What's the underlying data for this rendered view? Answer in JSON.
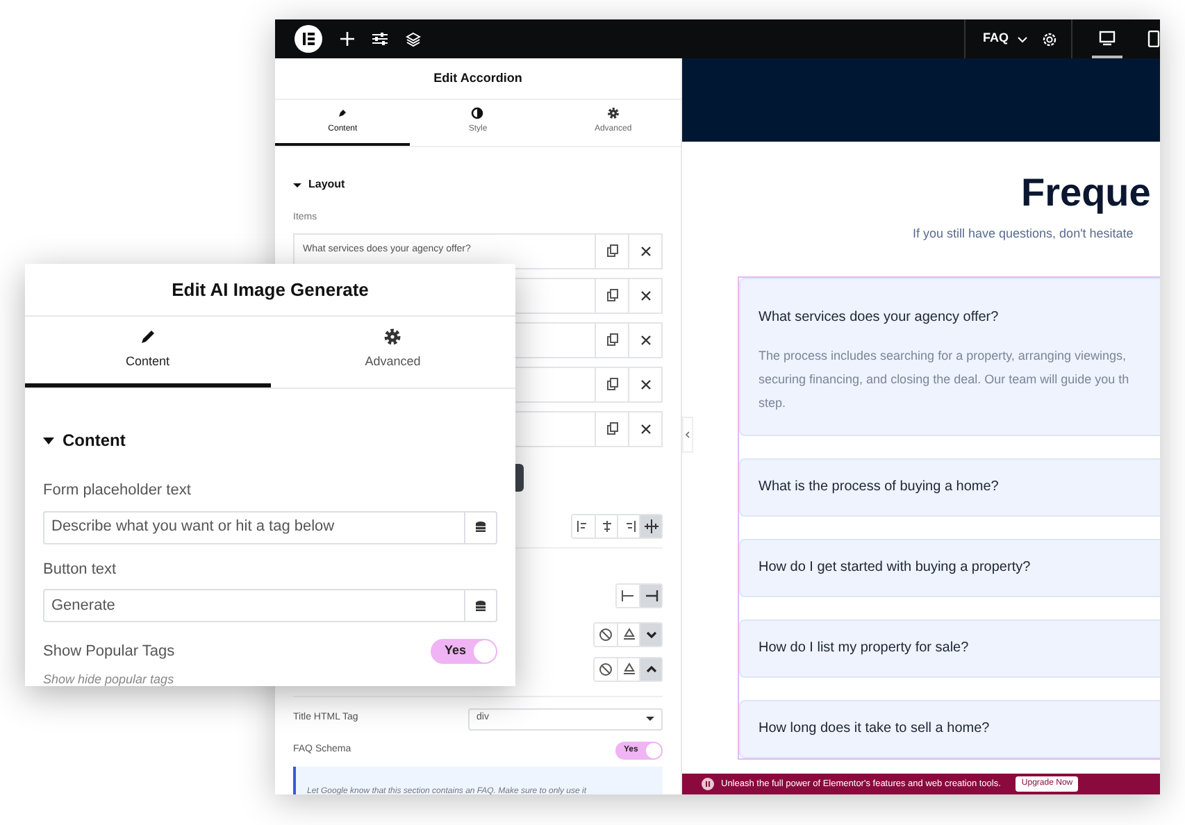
{
  "editor": {
    "toolbar": {
      "page_menu": "FAQ"
    },
    "panel": {
      "title": "Edit Accordion",
      "tabs": [
        {
          "label": "Content",
          "kind": "pencil",
          "selected": true
        },
        {
          "label": "Style",
          "kind": "contrast",
          "selected": false
        },
        {
          "label": "Advanced",
          "kind": "gear",
          "selected": false
        }
      ],
      "section": "Layout",
      "items_label": "Items",
      "items": [
        {
          "kind": "titled",
          "title": "What services does your agency offer?"
        },
        {
          "kind": "covered"
        },
        {
          "kind": "covered"
        },
        {
          "kind": "covered"
        },
        {
          "kind": "covered"
        }
      ],
      "control_groups": [
        [
          {
            "kind": "align-start",
            "selected": false
          },
          {
            "kind": "align-center",
            "selected": false
          },
          {
            "kind": "align-end",
            "selected": false
          },
          {
            "kind": "align-stretch",
            "selected": true
          }
        ],
        [
          {
            "kind": "start",
            "selected": false
          },
          {
            "kind": "end",
            "selected": true
          }
        ],
        [
          {
            "kind": "ban",
            "selected": false
          },
          {
            "kind": "drop",
            "selected": false
          },
          {
            "kind": "chevron-down",
            "selected": true
          }
        ],
        [
          {
            "kind": "ban",
            "selected": false
          },
          {
            "kind": "drop",
            "selected": false
          },
          {
            "kind": "chevron-up",
            "selected": true
          }
        ]
      ],
      "title_tag": {
        "label": "Title HTML Tag",
        "value": "div"
      },
      "faq_schema": {
        "label": "FAQ Schema",
        "on": true,
        "toggle_text": "Yes"
      },
      "note": "Let Google know that this section contains an FAQ. Make sure to only use it"
    },
    "preview": {
      "heading": "Freque",
      "subtitle": "If you still have questions, don't hesitate",
      "faqs": [
        {
          "question": "What services does your agency offer?",
          "expanded": true,
          "answer_lines": [
            "The process includes searching for a property, arranging viewings,",
            "securing financing, and closing the deal. Our team will guide you th",
            "step."
          ]
        },
        {
          "question": "What is the process of buying a home?",
          "expanded": false
        },
        {
          "question": "How do I get started with buying a property?",
          "expanded": false
        },
        {
          "question": "How do I list my property for sale?",
          "expanded": false
        },
        {
          "question": "How long does it take to sell a home?",
          "expanded": false
        }
      ],
      "banner": {
        "text": "Unleash the full power of Elementor's features and web creation tools.",
        "button": "Upgrade Now"
      }
    }
  },
  "overlay_panel": {
    "title": "Edit AI Image Generate",
    "tabs": [
      {
        "label": "Content",
        "kind": "pencil",
        "selected": true
      },
      {
        "label": "Advanced",
        "kind": "gear",
        "selected": false
      }
    ],
    "section": "Content",
    "fields": [
      {
        "label": "Form placeholder text",
        "value": "Describe what you want or hit a tag below"
      },
      {
        "label": "Button text",
        "value": "Generate"
      }
    ],
    "toggle": {
      "label": "Show Popular Tags",
      "on": true,
      "toggle_text": "Yes"
    },
    "hint": "Show hide popular tags"
  }
}
